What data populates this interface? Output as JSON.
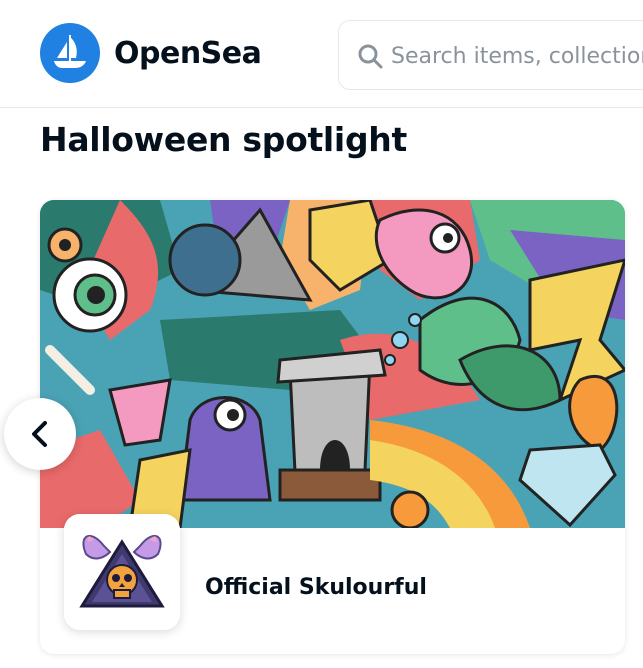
{
  "header": {
    "brand": "OpenSea",
    "logo_icon": "opensea-sailboat-icon",
    "search": {
      "placeholder": "Search items, collections, and accounts",
      "icon": "search-icon"
    }
  },
  "main": {
    "section_title": "Halloween spotlight",
    "carousel": {
      "prev_icon": "chevron-left-icon",
      "card": {
        "collection_name": "Official Skulourful",
        "banner_colors": [
          "#4aa3b5",
          "#e96a6a",
          "#f7b36b",
          "#7b63c4",
          "#f4d35e",
          "#5fbf8a",
          "#2a7a6e"
        ],
        "avatar_colors": {
          "triangle": "#3f3a6e",
          "wings": "#c59be8",
          "skull": "#f2a33c"
        }
      }
    }
  },
  "colors": {
    "brand": "#2081e2",
    "text": "#04111d",
    "placeholder": "#8a939b",
    "border": "#e5e8eb"
  }
}
